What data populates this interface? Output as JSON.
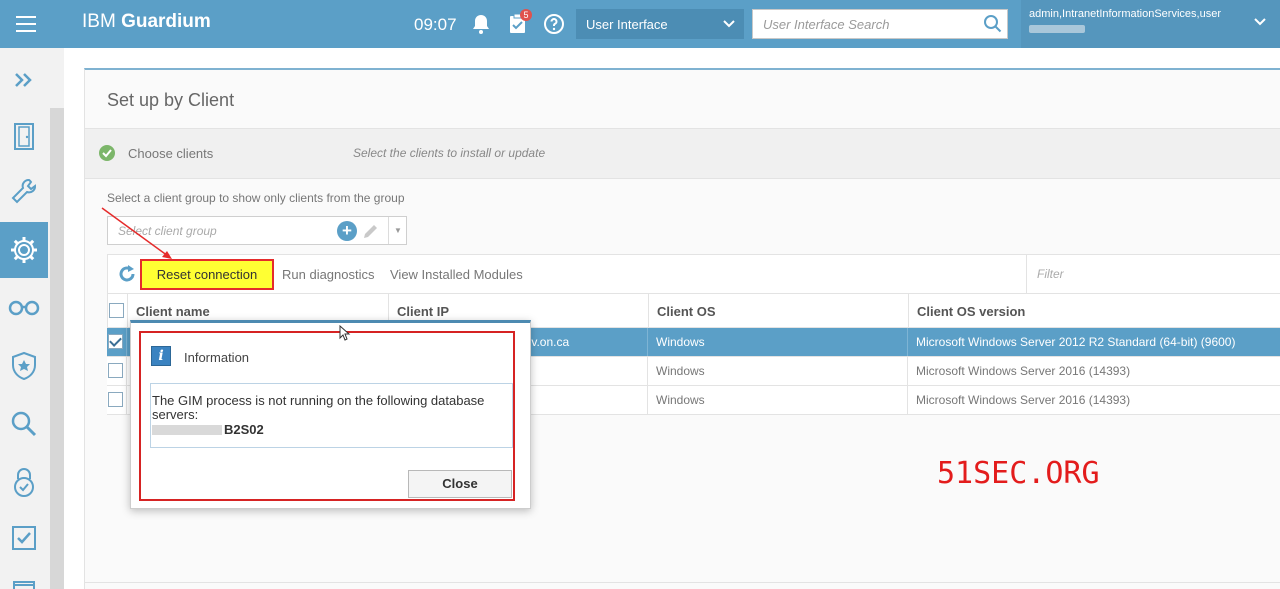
{
  "app": {
    "brand_light": "IBM ",
    "brand_bold": "Guardium"
  },
  "header": {
    "time": "09:07",
    "tasks_badge": "5",
    "view_selector": "User Interface",
    "search_placeholder": "User Interface Search",
    "user": "admin,IntranetInformationServices,user"
  },
  "sidebar": {
    "items": [
      "expand",
      "exit",
      "tools",
      "settings",
      "monitor",
      "protect",
      "investigate",
      "harden",
      "comply",
      "reports"
    ],
    "active": "settings"
  },
  "page": {
    "title": "Set up by Client",
    "step": {
      "label": "Choose clients",
      "description": "Select the clients to install or update"
    },
    "group_label": "Select a client group to show only clients from the group",
    "group_placeholder": "Select client group",
    "toolbar": {
      "reset": "Reset connection",
      "diagnostics": "Run diagnostics",
      "modules": "View Installed Modules",
      "filter_placeholder": "Filter"
    },
    "columns": [
      "Client name",
      "Client IP",
      "Client OS",
      "Client OS version"
    ],
    "rows": [
      {
        "name": "",
        "ip": "gov.on.ca",
        "os": "Windows",
        "version": "Microsoft Windows Server 2012 R2 Standard (64-bit) (9600)",
        "checked": true
      },
      {
        "name": "",
        "ip": "",
        "os": "Windows",
        "version": "Microsoft Windows Server 2016 (14393)",
        "checked": false
      },
      {
        "name": "",
        "ip": "",
        "os": "Windows",
        "version": "Microsoft Windows Server 2016 (14393)",
        "checked": false
      }
    ]
  },
  "dialog": {
    "title": "Information",
    "message": "The GIM process is not running on the following database servers:",
    "server": "B2S02",
    "close": "Close"
  },
  "watermark": "51SEC.ORG",
  "colors": {
    "header": "#5b9fc7",
    "highlight": "#ffff33",
    "annotation": "#e52b2b"
  }
}
